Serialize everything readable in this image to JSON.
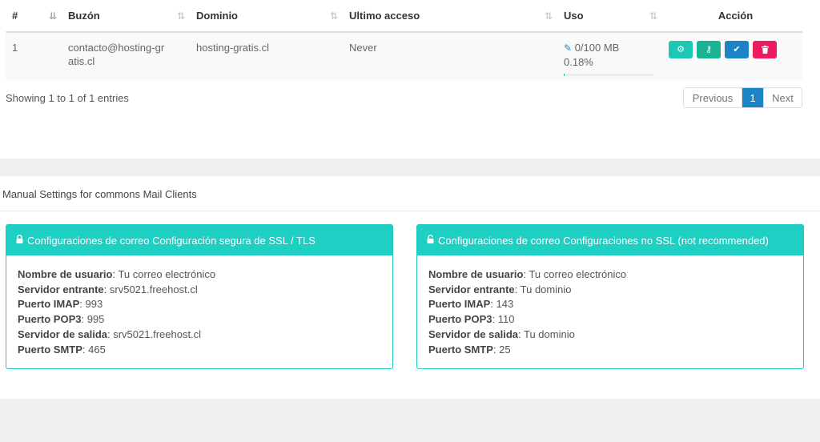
{
  "table": {
    "headers": {
      "num": "#",
      "buzon": "Buzón",
      "dominio": "Dominio",
      "ultimo": "Ultimo acceso",
      "uso": "Uso",
      "accion": "Acción"
    },
    "rows": [
      {
        "num": "1",
        "buzon": "contacto@hosting-gratis.cl",
        "dominio": "hosting-gratis.cl",
        "ultimo": "Never",
        "uso": "0/100 MB",
        "uso_pct": "0.18%",
        "uso_fraction": 0.0018
      }
    ]
  },
  "footer": {
    "showing": "Showing 1 to 1 of 1 entries"
  },
  "pagination": {
    "previous": "Previous",
    "page": "1",
    "next": "Next"
  },
  "settings": {
    "title": "Manual Settings for commons Mail Clients",
    "ssl": {
      "heading": "Configuraciones de correo Configuración segura de SSL / TLS",
      "icon": "lock-icon",
      "items": [
        {
          "label": "Nombre de usuario",
          "value": ": Tu correo electrónico"
        },
        {
          "label": "Servidor entrante",
          "value": ": srv5021.freehost.cl"
        },
        {
          "label": "Puerto IMAP",
          "value": ": 993"
        },
        {
          "label": "Puerto POP3",
          "value": ": 995"
        },
        {
          "label": "Servidor de salida",
          "value": ": srv5021.freehost.cl"
        },
        {
          "label": "Puerto SMTP",
          "value": ": 465"
        }
      ]
    },
    "nossl": {
      "heading": "Configuraciones de correo Configuraciones no SSL (not recommended)",
      "icon": "unlock-icon",
      "items": [
        {
          "label": "Nombre de usuario",
          "value": ": Tu correo electrónico"
        },
        {
          "label": "Servidor entrante",
          "value": ": Tu dominio"
        },
        {
          "label": "Puerto IMAP",
          "value": ": 143"
        },
        {
          "label": "Puerto POP3",
          "value": ": 110"
        },
        {
          "label": "Servidor de salida",
          "value": ": Tu dominio"
        },
        {
          "label": "Puerto SMTP",
          "value": ": 25"
        }
      ]
    }
  },
  "colors": {
    "accent_teal": "#1ecfc4",
    "primary_blue": "#1c84c6",
    "green": "#1ab394",
    "danger": "#ed1b5d"
  }
}
